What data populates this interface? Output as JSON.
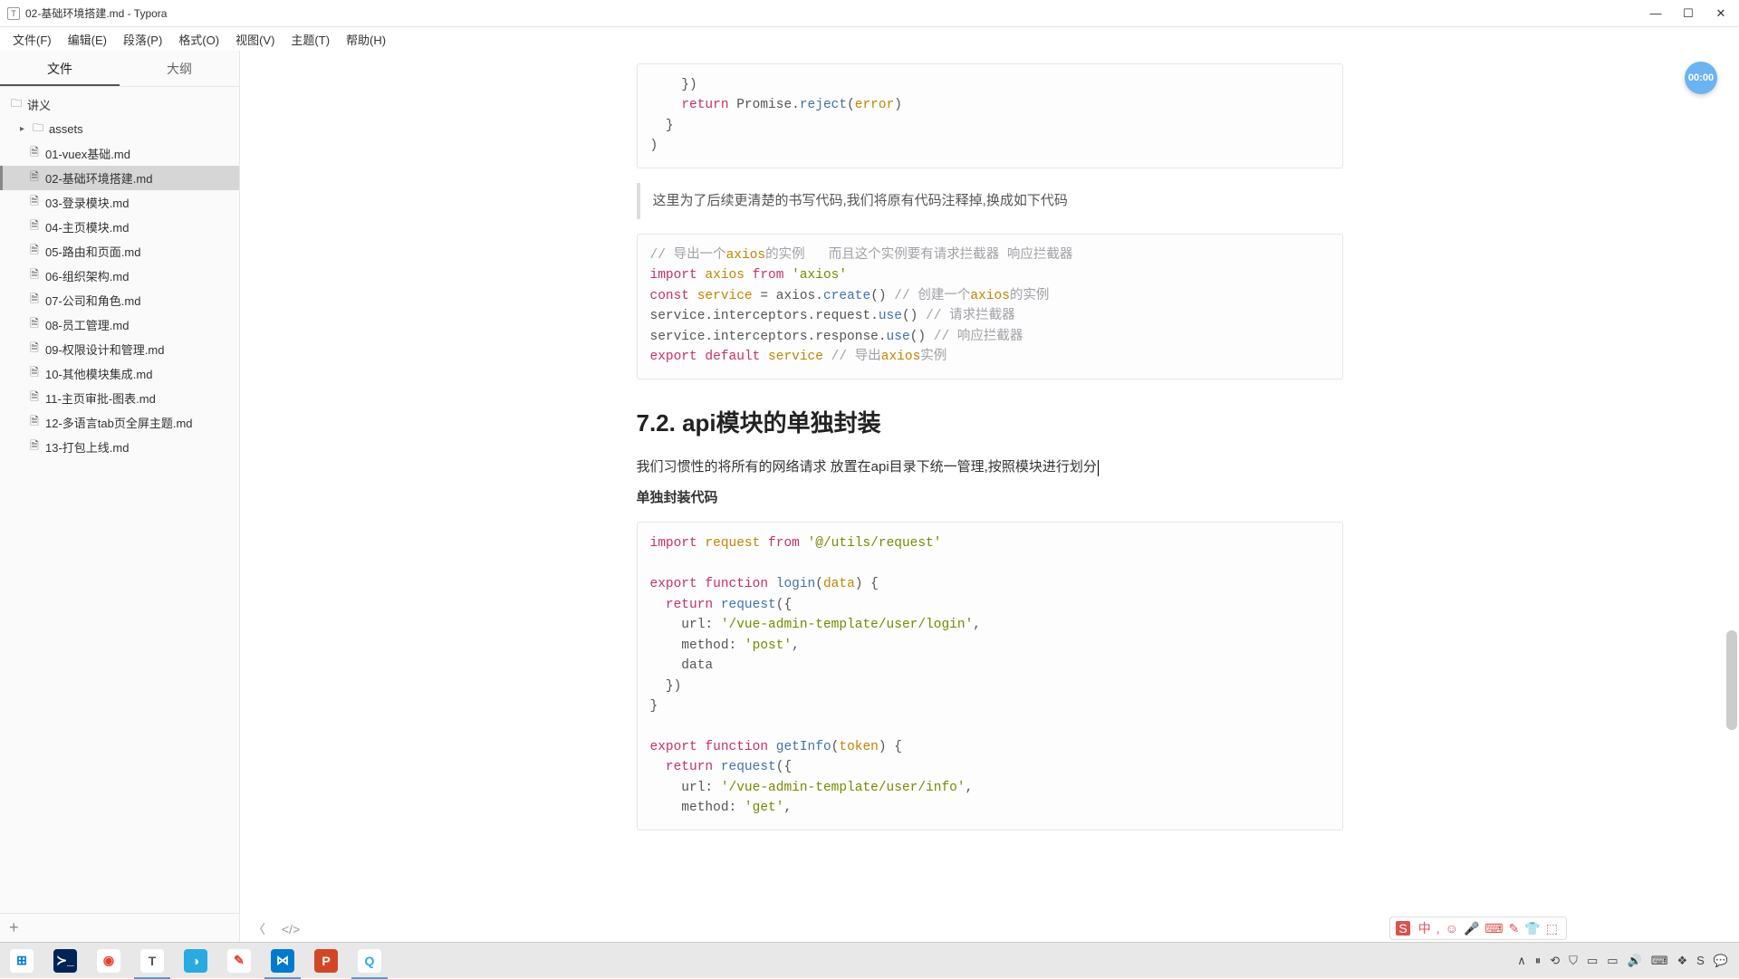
{
  "window": {
    "title": "02-基础环境搭建.md - Typora",
    "app_initial": "T"
  },
  "menubar": [
    "文件(F)",
    "编辑(E)",
    "段落(P)",
    "格式(O)",
    "视图(V)",
    "主题(T)",
    "帮助(H)"
  ],
  "sidebar": {
    "tabs": {
      "files": "文件",
      "outline": "大纲"
    },
    "root": "讲义",
    "folder": "assets",
    "items": [
      "01-vuex基础.md",
      "02-基础环境搭建.md",
      "03-登录模块.md",
      "04-主页模块.md",
      "05-路由和页面.md",
      "06-组织架构.md",
      "07-公司和角色.md",
      "08-员工管理.md",
      "09-权限设计和管理.md",
      "10-其他模块集成.md",
      "11-主页审批-图表.md",
      "12-多语言tab页全屏主题.md",
      "13-打包上线.md"
    ],
    "selected_index": 1
  },
  "editor": {
    "code1_lines": [
      [
        {
          "c": "tk-pl",
          "t": "    })"
        }
      ],
      [
        {
          "c": "tk-pl",
          "t": "    "
        },
        {
          "c": "tk-kw",
          "t": "return"
        },
        {
          "c": "tk-pl",
          "t": " Promise."
        },
        {
          "c": "tk-fn",
          "t": "reject"
        },
        {
          "c": "tk-pl",
          "t": "("
        },
        {
          "c": "tk-var",
          "t": "error"
        },
        {
          "c": "tk-pl",
          "t": ")"
        }
      ],
      [
        {
          "c": "tk-pl",
          "t": "  }"
        }
      ],
      [
        {
          "c": "tk-pl",
          "t": ")"
        }
      ]
    ],
    "note": "这里为了后续更清楚的书写代码,我们将原有代码注释掉,换成如下代码",
    "code2_lines": [
      [
        {
          "c": "tk-cmt",
          "t": "// 导出一个"
        },
        {
          "c": "tk-var",
          "t": "axios"
        },
        {
          "c": "tk-cmt",
          "t": "的实例   而且这个实例要有请求拦截器 响应拦截器"
        }
      ],
      [
        {
          "c": "tk-kw",
          "t": "import"
        },
        {
          "c": "tk-pl",
          "t": " "
        },
        {
          "c": "tk-var",
          "t": "axios"
        },
        {
          "c": "tk-pl",
          "t": " "
        },
        {
          "c": "tk-kw",
          "t": "from"
        },
        {
          "c": "tk-pl",
          "t": " "
        },
        {
          "c": "tk-str",
          "t": "'axios'"
        }
      ],
      [
        {
          "c": "tk-kw",
          "t": "const"
        },
        {
          "c": "tk-pl",
          "t": " "
        },
        {
          "c": "tk-var",
          "t": "service"
        },
        {
          "c": "tk-pl",
          "t": " = axios."
        },
        {
          "c": "tk-fn",
          "t": "create"
        },
        {
          "c": "tk-pl",
          "t": "() "
        },
        {
          "c": "tk-cmt",
          "t": "// 创建一个"
        },
        {
          "c": "tk-var",
          "t": "axios"
        },
        {
          "c": "tk-cmt",
          "t": "的实例"
        }
      ],
      [
        {
          "c": "tk-pl",
          "t": "service.interceptors.request."
        },
        {
          "c": "tk-fn",
          "t": "use"
        },
        {
          "c": "tk-pl",
          "t": "() "
        },
        {
          "c": "tk-cmt",
          "t": "// 请求拦截器"
        }
      ],
      [
        {
          "c": "tk-pl",
          "t": "service.interceptors.response."
        },
        {
          "c": "tk-fn",
          "t": "use"
        },
        {
          "c": "tk-pl",
          "t": "() "
        },
        {
          "c": "tk-cmt",
          "t": "// 响应拦截器"
        }
      ],
      [
        {
          "c": "tk-kw",
          "t": "export"
        },
        {
          "c": "tk-pl",
          "t": " "
        },
        {
          "c": "tk-kw",
          "t": "default"
        },
        {
          "c": "tk-pl",
          "t": " "
        },
        {
          "c": "tk-var",
          "t": "service"
        },
        {
          "c": "tk-pl",
          "t": " "
        },
        {
          "c": "tk-cmt",
          "t": "// 导出"
        },
        {
          "c": "tk-var",
          "t": "axios"
        },
        {
          "c": "tk-cmt",
          "t": "实例"
        }
      ]
    ],
    "heading": "7.2. api模块的单独封装",
    "para1": "我们习惯性的将所有的网络请求 放置在api目录下统一管理,按照模块进行划分",
    "para2": "单独封装代码",
    "code3_lines": [
      [
        {
          "c": "tk-kw",
          "t": "import"
        },
        {
          "c": "tk-pl",
          "t": " "
        },
        {
          "c": "tk-var",
          "t": "request"
        },
        {
          "c": "tk-pl",
          "t": " "
        },
        {
          "c": "tk-kw",
          "t": "from"
        },
        {
          "c": "tk-pl",
          "t": " "
        },
        {
          "c": "tk-str",
          "t": "'@/utils/request'"
        }
      ],
      [
        {
          "c": "tk-pl",
          "t": ""
        }
      ],
      [
        {
          "c": "tk-kw",
          "t": "export"
        },
        {
          "c": "tk-pl",
          "t": " "
        },
        {
          "c": "tk-kw",
          "t": "function"
        },
        {
          "c": "tk-pl",
          "t": " "
        },
        {
          "c": "tk-fn",
          "t": "login"
        },
        {
          "c": "tk-pl",
          "t": "("
        },
        {
          "c": "tk-var",
          "t": "data"
        },
        {
          "c": "tk-pl",
          "t": ") {"
        }
      ],
      [
        {
          "c": "tk-pl",
          "t": "  "
        },
        {
          "c": "tk-kw",
          "t": "return"
        },
        {
          "c": "tk-pl",
          "t": " "
        },
        {
          "c": "tk-fn",
          "t": "request"
        },
        {
          "c": "tk-pl",
          "t": "({"
        }
      ],
      [
        {
          "c": "tk-pl",
          "t": "    url: "
        },
        {
          "c": "tk-str",
          "t": "'/vue-admin-template/user/login'"
        },
        {
          "c": "tk-pl",
          "t": ","
        }
      ],
      [
        {
          "c": "tk-pl",
          "t": "    method: "
        },
        {
          "c": "tk-str",
          "t": "'post'"
        },
        {
          "c": "tk-pl",
          "t": ","
        }
      ],
      [
        {
          "c": "tk-pl",
          "t": "    data"
        }
      ],
      [
        {
          "c": "tk-pl",
          "t": "  })"
        }
      ],
      [
        {
          "c": "tk-pl",
          "t": "}"
        }
      ],
      [
        {
          "c": "tk-pl",
          "t": ""
        }
      ],
      [
        {
          "c": "tk-kw",
          "t": "export"
        },
        {
          "c": "tk-pl",
          "t": " "
        },
        {
          "c": "tk-kw",
          "t": "function"
        },
        {
          "c": "tk-pl",
          "t": " "
        },
        {
          "c": "tk-fn",
          "t": "getInfo"
        },
        {
          "c": "tk-pl",
          "t": "("
        },
        {
          "c": "tk-var",
          "t": "token"
        },
        {
          "c": "tk-pl",
          "t": ") {"
        }
      ],
      [
        {
          "c": "tk-pl",
          "t": "  "
        },
        {
          "c": "tk-kw",
          "t": "return"
        },
        {
          "c": "tk-pl",
          "t": " "
        },
        {
          "c": "tk-fn",
          "t": "request"
        },
        {
          "c": "tk-pl",
          "t": "({"
        }
      ],
      [
        {
          "c": "tk-pl",
          "t": "    url: "
        },
        {
          "c": "tk-str",
          "t": "'/vue-admin-template/user/info'"
        },
        {
          "c": "tk-pl",
          "t": ","
        }
      ],
      [
        {
          "c": "tk-pl",
          "t": "    method: "
        },
        {
          "c": "tk-str",
          "t": "'get'"
        },
        {
          "c": "tk-pl",
          "t": ","
        }
      ]
    ]
  },
  "float_badge": "00:00",
  "ime": [
    "中",
    ",",
    "☺",
    "🎤",
    "⌨",
    "✎",
    "👕",
    "⬚"
  ],
  "taskbar": {
    "apps": [
      {
        "name": "start",
        "glyph": "⊞",
        "bg": "#fff",
        "fg": "#0078d7"
      },
      {
        "name": "powershell",
        "glyph": "≻_",
        "bg": "#012456",
        "fg": "#fff"
      },
      {
        "name": "chrome",
        "glyph": "◉",
        "bg": "#fff",
        "fg": "#e34133"
      },
      {
        "name": "typora",
        "glyph": "T",
        "bg": "#fff",
        "fg": "#555",
        "active": true
      },
      {
        "name": "app5",
        "glyph": "◑",
        "bg": "#29abe2",
        "fg": "#fff"
      },
      {
        "name": "app6",
        "glyph": "✎",
        "bg": "#fff",
        "fg": "#e34133"
      },
      {
        "name": "vscode",
        "glyph": "⋈",
        "bg": "#007acc",
        "fg": "#fff",
        "active": true
      },
      {
        "name": "powerpoint",
        "glyph": "P",
        "bg": "#d24726",
        "fg": "#fff"
      },
      {
        "name": "app9",
        "glyph": "Q",
        "bg": "#fff",
        "fg": "#29abe2",
        "active": true
      }
    ],
    "tray": [
      "∧",
      "⏸",
      "⟲",
      "⛉",
      "▭",
      "▭",
      "🔊",
      "⌨",
      "❖",
      "S",
      "💬"
    ]
  }
}
